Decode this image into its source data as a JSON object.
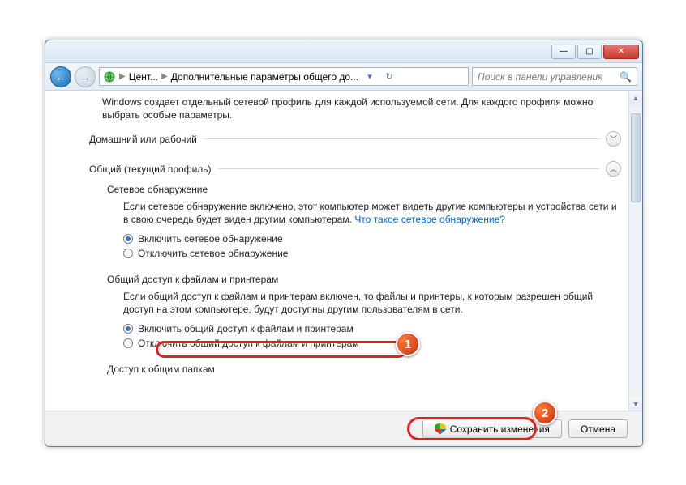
{
  "titlebar": {
    "min": "—",
    "max": "▢",
    "close": "✕"
  },
  "nav": {
    "crumb1": "Цент...",
    "crumb2": "Дополнительные параметры общего до...",
    "search_placeholder": "Поиск в панели управления"
  },
  "intro": "Windows создает отдельный сетевой профиль для каждой используемой сети. Для каждого профиля можно выбрать особые параметры.",
  "sections": {
    "home": {
      "title": "Домашний или рабочий"
    },
    "public": {
      "title": "Общий (текущий профиль)",
      "netdisc": {
        "title": "Сетевое обнаружение",
        "para_a": "Если сетевое обнаружение включено, этот компьютер может видеть другие компьютеры и устройства сети и в свою очередь будет виден другим компьютерам. ",
        "link": "Что такое сетевое обнаружение?",
        "opt_on": "Включить сетевое обнаружение",
        "opt_off": "Отключить сетевое обнаружение"
      },
      "fileshare": {
        "title": "Общий доступ к файлам и принтерам",
        "para": "Если общий доступ к файлам и принтерам включен, то файлы и принтеры, к которым разрешен общий доступ на этом компьютере, будут доступны другим пользователям в сети.",
        "opt_on": "Включить общий доступ к файлам и принтерам",
        "opt_off": "Отключить общий доступ к файлам и принтерам"
      },
      "pubfolders": {
        "title": "Доступ к общим папкам"
      }
    }
  },
  "footer": {
    "save": "Сохранить изменения",
    "cancel": "Отмена"
  },
  "badges": {
    "one": "1",
    "two": "2"
  }
}
